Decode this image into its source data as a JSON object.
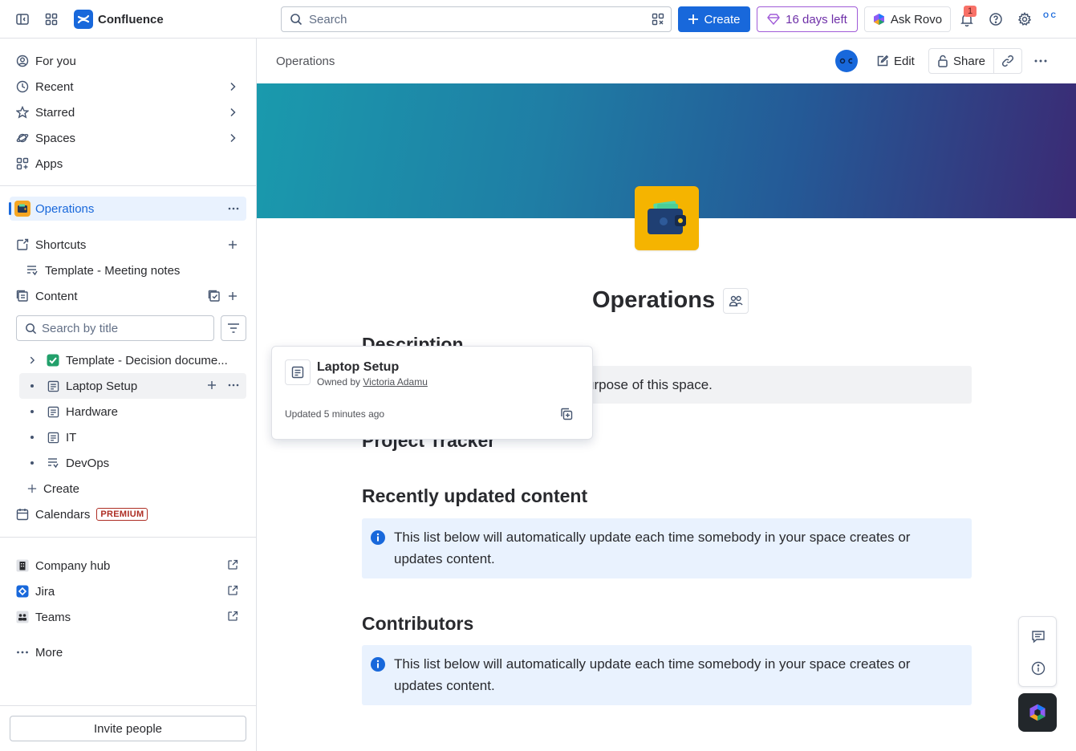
{
  "topbar": {
    "app_name": "Confluence",
    "search_placeholder": "Search",
    "create_label": "Create",
    "trial_label": "16 days left",
    "rovo_label": "Ask Rovo",
    "notification_count": "1",
    "avatar_initials": "O C"
  },
  "sidebar": {
    "nav": [
      {
        "label": "For you",
        "icon": "user-circle-icon"
      },
      {
        "label": "Recent",
        "icon": "clock-icon"
      },
      {
        "label": "Starred",
        "icon": "star-icon"
      },
      {
        "label": "Spaces",
        "icon": "planet-icon"
      },
      {
        "label": "Apps",
        "icon": "apps-icon"
      }
    ],
    "space_name": "Operations",
    "shortcuts_label": "Shortcuts",
    "shortcut_item": "Template - Meeting notes",
    "content_label": "Content",
    "search_title_placeholder": "Search by title",
    "tree": [
      {
        "label": "Template - Decision docume...",
        "icon": "check-emoji-icon"
      },
      {
        "label": "Laptop Setup",
        "icon": "page-icon"
      },
      {
        "label": "Hardware",
        "icon": "page-icon"
      },
      {
        "label": "IT",
        "icon": "page-icon"
      },
      {
        "label": "DevOps",
        "icon": "live-doc-icon"
      }
    ],
    "create_label": "Create",
    "calendars_label": "Calendars",
    "premium_badge": "PREMIUM",
    "apps": [
      {
        "label": "Company hub",
        "icon": "building-icon"
      },
      {
        "label": "Jira",
        "icon": "jira-icon"
      },
      {
        "label": "Teams",
        "icon": "teams-icon"
      }
    ],
    "more_label": "More",
    "invite_label": "Invite people"
  },
  "header": {
    "breadcrumb": "Operations",
    "edit_label": "Edit",
    "share_label": "Share"
  },
  "page": {
    "title": "Operations",
    "description_heading": "Description",
    "description_text": "urpose of this space.",
    "project_heading": "Project Tracker",
    "recent_heading": "Recently updated content",
    "recent_info": "This list below will automatically update each time somebody in your space creates or updates content.",
    "contributors_heading": "Contributors",
    "contributors_info": "This list below will automatically update each time somebody in your space creates or updates content."
  },
  "hovercard": {
    "title": "Laptop Setup",
    "owner_prefix": "Owned by",
    "owner_name": "Victoria Adamu",
    "updated": "Updated 5 minutes ago"
  },
  "colors": {
    "brand": "#1868db",
    "trial": "#a05bd8",
    "selected_bg": "#e9f2fe",
    "info_bg": "#e9f2fe"
  }
}
